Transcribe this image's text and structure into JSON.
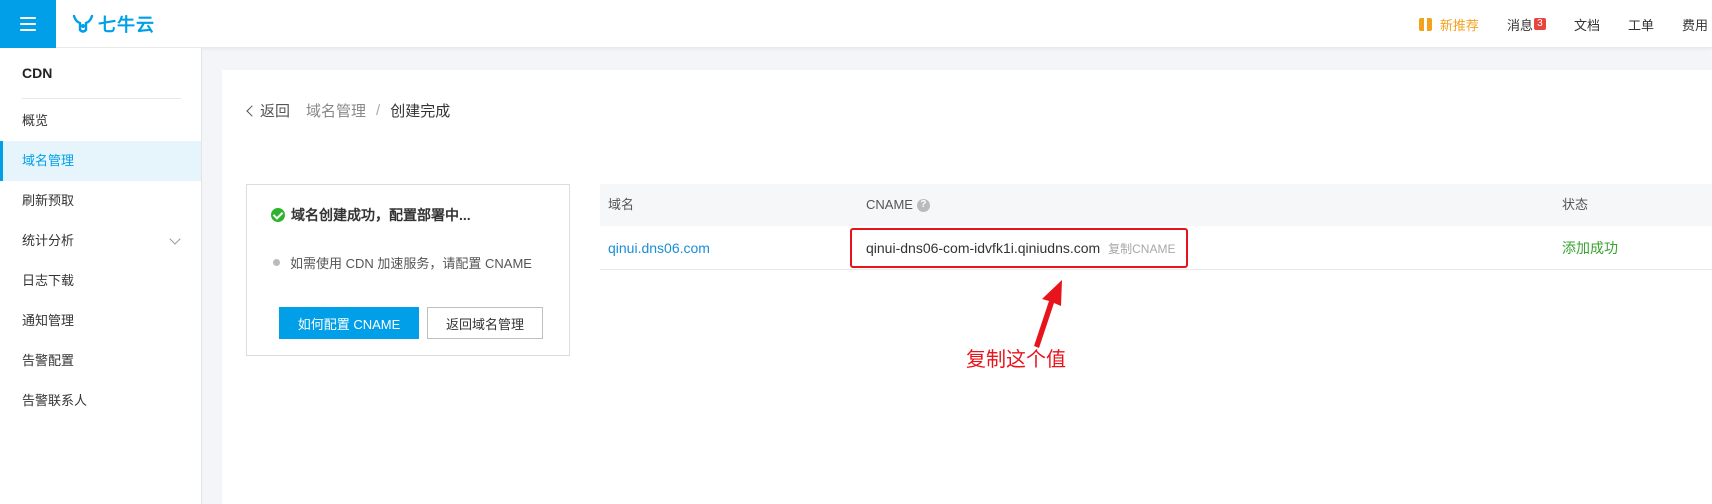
{
  "brand": {
    "name": "七牛云",
    "accent": "#009fe8"
  },
  "topnav": {
    "promo": "新推荐",
    "messages": "消息",
    "messages_count": "3",
    "docs": "文档",
    "tickets": "工单",
    "billing": "费用"
  },
  "sidebar": {
    "product": "CDN",
    "items": [
      {
        "label": "概览"
      },
      {
        "label": "域名管理",
        "active": true
      },
      {
        "label": "刷新预取"
      },
      {
        "label": "统计分析",
        "expandable": true
      },
      {
        "label": "日志下载"
      },
      {
        "label": "通知管理"
      },
      {
        "label": "告警配置"
      },
      {
        "label": "告警联系人"
      }
    ]
  },
  "breadcrumb": {
    "back": "返回",
    "parent": "域名管理",
    "separator": "/",
    "current": "创建完成"
  },
  "status_card": {
    "success_text": "域名创建成功，配置部署中...",
    "hint_text": "如需使用 CDN 加速服务，请配置 CNAME",
    "primary_button": "如何配置 CNAME",
    "secondary_button": "返回域名管理"
  },
  "table": {
    "columns": {
      "domain": "域名",
      "cname": "CNAME",
      "status": "状态"
    },
    "rows": [
      {
        "domain": "qinui.dns06.com",
        "cname": "qinui-dns06-com-idvfk1i.qiniudns.com",
        "copy": "复制CNAME",
        "status": "添加成功"
      }
    ]
  },
  "annotation": {
    "text": "复制这个值",
    "color": "#e8141b"
  }
}
